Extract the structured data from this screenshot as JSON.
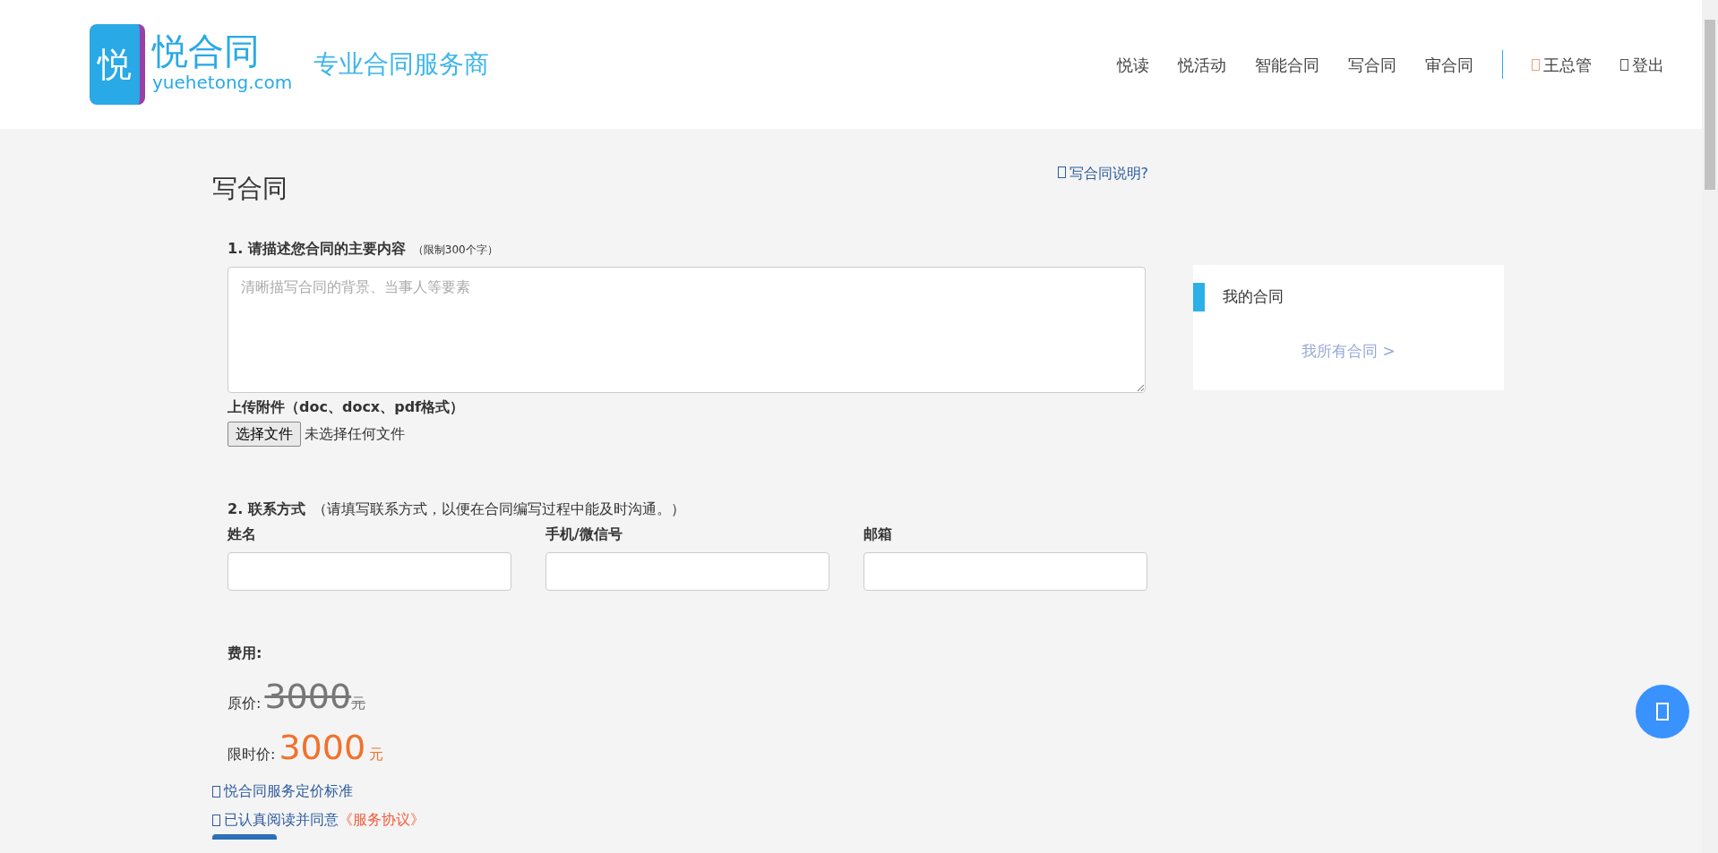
{
  "header": {
    "logo": {
      "glyph": "悦",
      "name": "悦合同",
      "domain": "yuehetong.com"
    },
    "tagline": "专业合同服务商",
    "nav": [
      {
        "label": "悦读"
      },
      {
        "label": "悦活动"
      },
      {
        "label": "智能合同"
      },
      {
        "label": "写合同"
      },
      {
        "label": "审合同"
      }
    ],
    "user_links": [
      {
        "label": "王总管"
      },
      {
        "label": "登出"
      }
    ]
  },
  "page": {
    "title": "写合同",
    "help_link": "写合同说明?"
  },
  "form": {
    "content": {
      "label": "1. 请描述您合同的主要内容",
      "note": "（限制300个字）",
      "placeholder": "清晰描写合同的背景、当事人等要素"
    },
    "attachment": {
      "label": "上传附件（doc、docx、pdf格式）",
      "button": "选择文件",
      "status": "未选择任何文件"
    },
    "contact": {
      "label": "2. 联系方式",
      "note": "（请填写联系方式，以便在合同编写过程中能及时沟通。）",
      "fields": [
        {
          "label": "姓名"
        },
        {
          "label": "手机/微信号"
        },
        {
          "label": "邮箱"
        }
      ]
    },
    "fee": {
      "label": "费用:",
      "original_label": "原价:",
      "original_price": "3000",
      "original_unit": "元",
      "sale_label": "限时价:",
      "sale_price": "3000",
      "sale_unit": "元"
    },
    "pricing_link": "悦合同服务定价标准",
    "agreement": {
      "text": "已认真阅读并同意",
      "link": "《服务协议》"
    }
  },
  "sidebar": {
    "title": "我的合同",
    "link": "我所有合同 >"
  }
}
